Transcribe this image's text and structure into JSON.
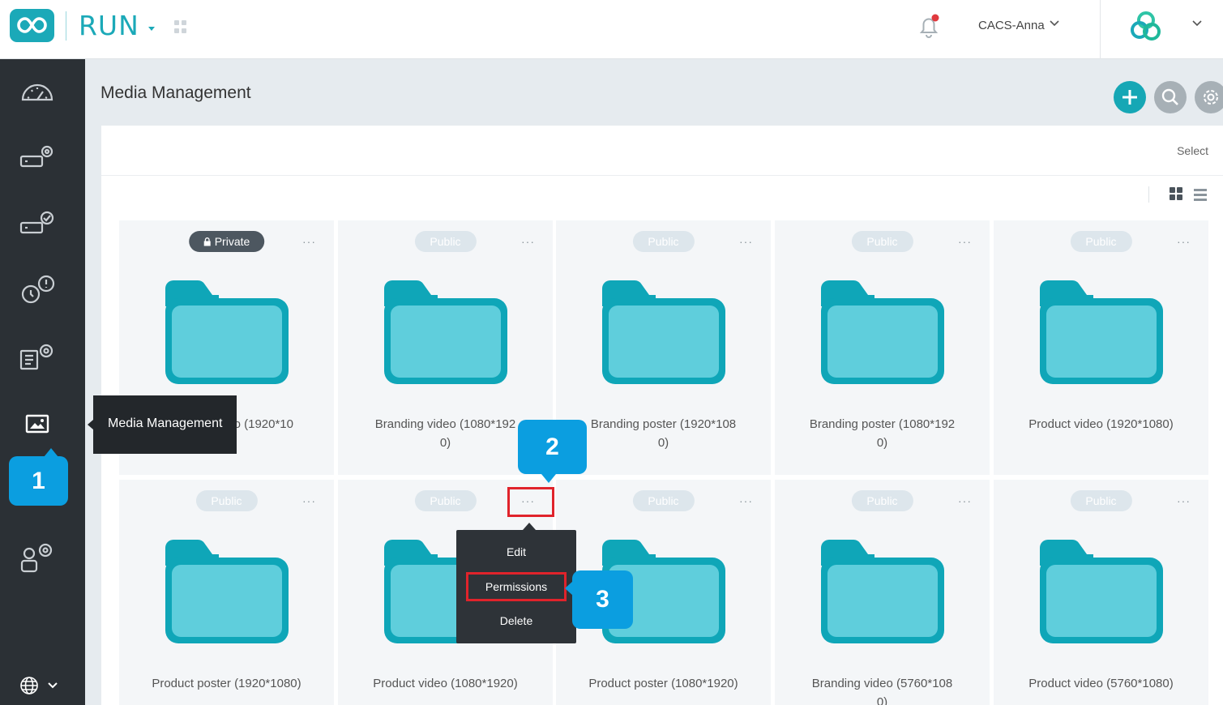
{
  "header": {
    "app_name": "RUN",
    "user_name": "CACS-Anna",
    "icons": [
      "infinity-logo-icon",
      "apps-grid-icon",
      "notification-bell-icon",
      "brand-logo-icon"
    ],
    "accent_color": "#1ba9b8",
    "notification_dot_color": "#e0393e"
  },
  "sidebar": {
    "items": [
      {
        "icon": "dashboard-gauge-icon"
      },
      {
        "icon": "device-settings-icon"
      },
      {
        "icon": "device-check-icon"
      },
      {
        "icon": "alerts-icon"
      },
      {
        "icon": "content-settings-icon"
      },
      {
        "icon": "media-image-icon",
        "active": true
      },
      {
        "icon": "user-settings-icon"
      }
    ],
    "footer_icon": "globe-icon"
  },
  "page": {
    "title": "Media Management",
    "select_label": "Select",
    "actions": [
      "add-icon",
      "search-icon",
      "gear-icon"
    ]
  },
  "tooltip": {
    "text": "Media Management"
  },
  "cards": [
    {
      "badge": "Private",
      "name": "Product video (1920*1080)",
      "visible_name": "o (1920*10"
    },
    {
      "badge": "Public",
      "name": "Branding video (1080*1920)"
    },
    {
      "badge": "Public",
      "name": "Branding poster (1920*1080)"
    },
    {
      "badge": "Public",
      "name": "Branding poster (1080*1920)"
    },
    {
      "badge": "Public",
      "name": "Product video (1920*1080)"
    },
    {
      "badge": "Public",
      "name": "Product poster (1920*1080)"
    },
    {
      "badge": "Public",
      "name": "Product video (1080*1920)"
    },
    {
      "badge": "Public",
      "name": "Product poster (1080*1920)"
    },
    {
      "badge": "Public",
      "name": "Branding video (5760*1080)"
    },
    {
      "badge": "Public",
      "name": "Product video (5760*1080)"
    }
  ],
  "card_more": "···",
  "context_menu": {
    "items": [
      "Edit",
      "Permissions",
      "Delete"
    ]
  },
  "callouts": [
    "1",
    "2",
    "3"
  ],
  "colors": {
    "callout": "#0b9ee0",
    "highlight": "#e0232b",
    "folder": "#5fcedc",
    "folder_outline": "#0fa6b8",
    "sidebar_bg": "#2b3035"
  }
}
